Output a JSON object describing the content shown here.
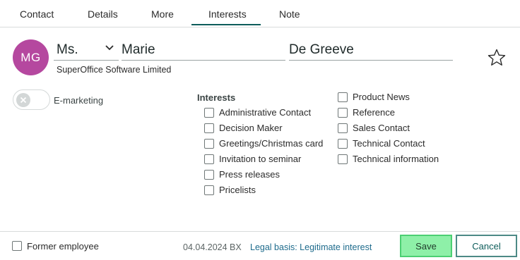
{
  "tabs": [
    {
      "label": "Contact",
      "active": false
    },
    {
      "label": "Details",
      "active": false
    },
    {
      "label": "More",
      "active": false
    },
    {
      "label": "Interests",
      "active": true
    },
    {
      "label": "Note",
      "active": false
    }
  ],
  "contact": {
    "initials": "MG",
    "title_value": "Ms.",
    "first_name": "Marie",
    "last_name": "De Greeve",
    "company": "SuperOffice Software Limited",
    "favorite": false
  },
  "emarketing": {
    "label": "E-marketing",
    "enabled": false
  },
  "interests": {
    "heading": "Interests",
    "column1": [
      {
        "label": "Administrative Contact",
        "checked": false
      },
      {
        "label": "Decision Maker",
        "checked": false
      },
      {
        "label": "Greetings/Christmas card",
        "checked": false
      },
      {
        "label": "Invitation to seminar",
        "checked": false
      },
      {
        "label": "Press releases",
        "checked": false
      },
      {
        "label": "Pricelists",
        "checked": false
      }
    ],
    "column2": [
      {
        "label": "Product News",
        "checked": false
      },
      {
        "label": "Reference",
        "checked": false
      },
      {
        "label": "Sales Contact",
        "checked": false
      },
      {
        "label": "Technical Contact",
        "checked": false
      },
      {
        "label": "Technical information",
        "checked": false
      }
    ]
  },
  "footer": {
    "former_employee_label": "Former employee",
    "former_employee_checked": false,
    "date_text": "04.04.2024 BX",
    "legal_basis": "Legal basis: Legitimate interest",
    "save_label": "Save",
    "cancel_label": "Cancel"
  },
  "colors": {
    "avatar": "#b5489f",
    "accent": "#0d5c5a",
    "save_bg": "#8ef0a8",
    "link": "#1e6b8c"
  }
}
